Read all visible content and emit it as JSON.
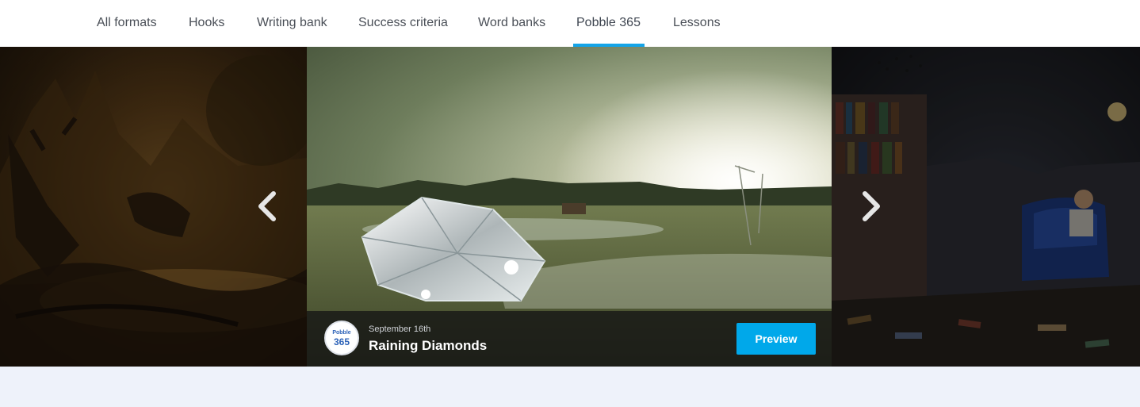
{
  "nav": {
    "tabs": [
      {
        "label": "All formats"
      },
      {
        "label": "Hooks"
      },
      {
        "label": "Writing bank"
      },
      {
        "label": "Success criteria"
      },
      {
        "label": "Word banks"
      },
      {
        "label": "Pobble 365",
        "active": true
      },
      {
        "label": "Lessons"
      }
    ]
  },
  "carousel": {
    "prev_icon": "chevron-left-icon",
    "next_icon": "chevron-right-icon",
    "current": {
      "date": "September 16th",
      "title": "Raining Diamonds",
      "logo_line1": "Pobble",
      "logo_line2": "365",
      "preview_label": "Preview"
    }
  },
  "colors": {
    "accent": "#14a4e8",
    "button": "#00a8ea",
    "page_bg": "#eef2fa"
  }
}
